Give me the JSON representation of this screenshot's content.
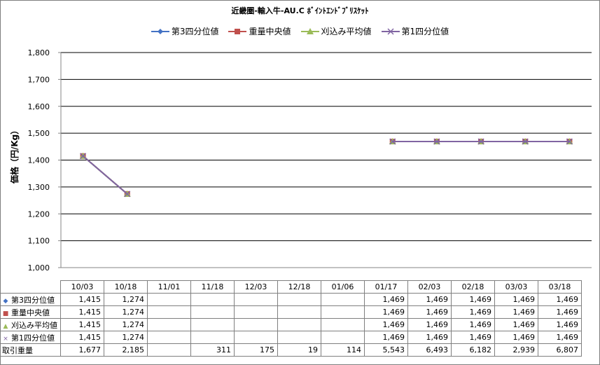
{
  "chart_data": {
    "type": "line",
    "title": "近畿圏-輸入牛-AU.C ﾎﾞｲﾝﾄｴﾝﾄﾞﾌﾞﾘｽｹｯﾄ",
    "ylabel": "価格（円/Kg）",
    "xlabel": "",
    "ylim": [
      1000,
      1800
    ],
    "yticks": [
      "1,000",
      "1,100",
      "1,200",
      "1,300",
      "1,400",
      "1,500",
      "1,600",
      "1,700",
      "1,800"
    ],
    "categories": [
      "10/03",
      "10/18",
      "11/01",
      "11/18",
      "12/03",
      "12/18",
      "01/06",
      "01/17",
      "02/03",
      "02/18",
      "03/03",
      "03/18"
    ],
    "series": [
      {
        "name": "第3四分位値",
        "color": "#4472c4",
        "marker": "diamond",
        "values": [
          1415,
          1274,
          null,
          null,
          null,
          null,
          null,
          1469,
          1469,
          1469,
          1469,
          1469
        ]
      },
      {
        "name": "重量中央値",
        "color": "#c0504d",
        "marker": "square",
        "values": [
          1415,
          1274,
          null,
          null,
          null,
          null,
          null,
          1469,
          1469,
          1469,
          1469,
          1469
        ]
      },
      {
        "name": "刈込み平均値",
        "color": "#9bbb59",
        "marker": "triangle",
        "values": [
          1415,
          1274,
          null,
          null,
          null,
          null,
          null,
          1469,
          1469,
          1469,
          1469,
          1469
        ]
      },
      {
        "name": "第1四分位値",
        "color": "#8064a2",
        "marker": "x",
        "values": [
          1415,
          1274,
          null,
          null,
          null,
          null,
          null,
          1469,
          1469,
          1469,
          1469,
          1469
        ]
      }
    ],
    "table": {
      "series_rows": [
        [
          "1,415",
          "1,274",
          "",
          "",
          "",
          "",
          "",
          "1,469",
          "1,469",
          "1,469",
          "1,469",
          "1,469"
        ],
        [
          "1,415",
          "1,274",
          "",
          "",
          "",
          "",
          "",
          "1,469",
          "1,469",
          "1,469",
          "1,469",
          "1,469"
        ],
        [
          "1,415",
          "1,274",
          "",
          "",
          "",
          "",
          "",
          "1,469",
          "1,469",
          "1,469",
          "1,469",
          "1,469"
        ],
        [
          "1,415",
          "1,274",
          "",
          "",
          "",
          "",
          "",
          "1,469",
          "1,469",
          "1,469",
          "1,469",
          "1,469"
        ]
      ],
      "volume_label": "取引重量",
      "volume": [
        "1,677",
        "2,185",
        "",
        "311",
        "175",
        "19",
        "114",
        "5,543",
        "6,493",
        "6,182",
        "2,939",
        "6,807"
      ]
    },
    "grid": true,
    "legend_position": "top"
  }
}
